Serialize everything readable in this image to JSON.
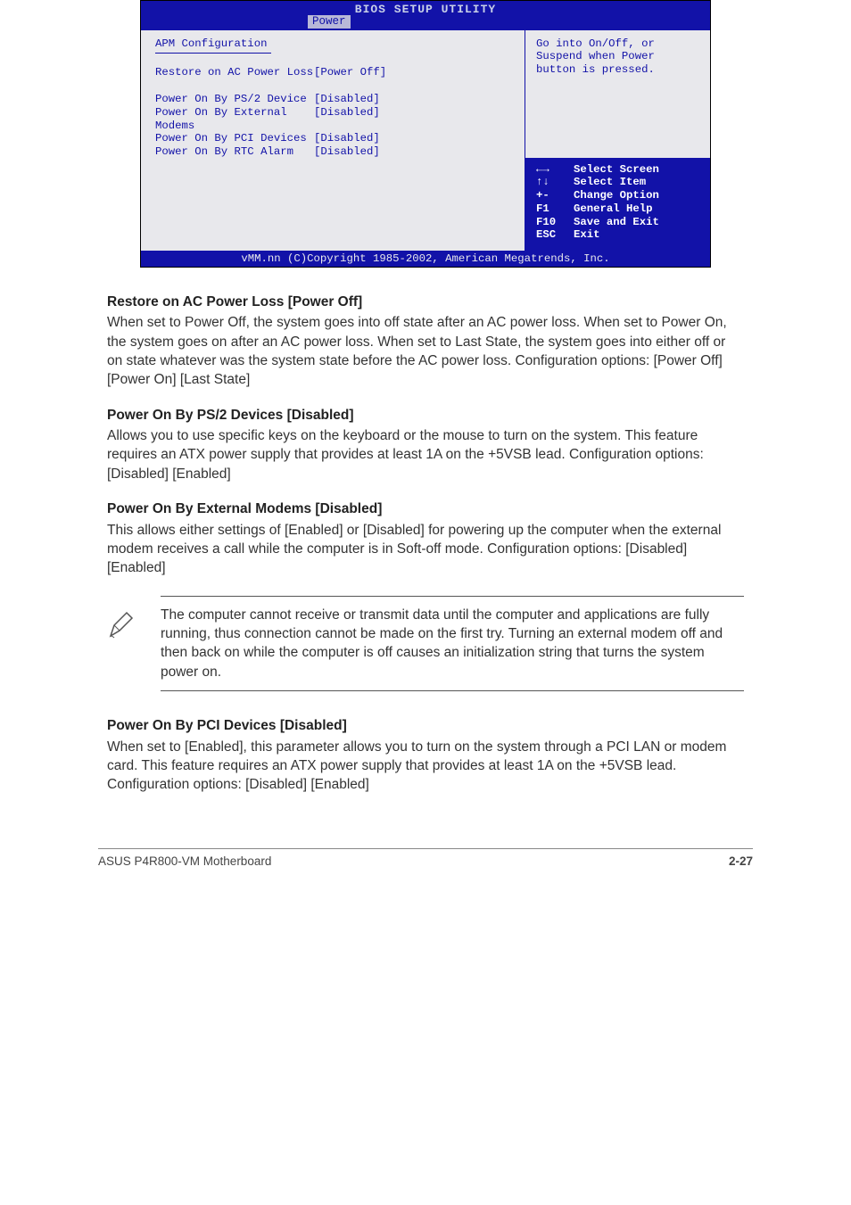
{
  "bios": {
    "title": "BIOS SETUP UTILITY",
    "active_tab": "Power",
    "left": {
      "section_heading": "APM Configuration",
      "settings": [
        {
          "label": "Restore on AC Power Loss",
          "value": "[Power Off]"
        }
      ],
      "settings2": [
        {
          "label": "Power On By PS/2 Device",
          "value": "[Disabled]"
        },
        {
          "label": "Power On By External Modems",
          "value": "[Disabled]"
        },
        {
          "label": "Power On By PCI Devices",
          "value": "[Disabled]"
        },
        {
          "label": "Power On By RTC Alarm",
          "value": "[Disabled]"
        }
      ]
    },
    "right": {
      "help": "Go into On/Off, or Suspend when Power button is pressed.",
      "nav": [
        {
          "key": "←→",
          "action": "Select Screen"
        },
        {
          "key": "↑↓",
          "action": "Select Item"
        },
        {
          "key": "+-",
          "action": "Change Option"
        },
        {
          "key": "F1",
          "action": "General Help"
        },
        {
          "key": "F10",
          "action": "Save and Exit"
        },
        {
          "key": "ESC",
          "action": "Exit"
        }
      ]
    },
    "footer": "vMM.nn (C)Copyright 1985-2002, American Megatrends, Inc."
  },
  "doc": {
    "h1": {
      "title": "Restore on AC Power Loss [Power Off]",
      "body": "When set to Power Off, the system goes into off state after an AC power loss. When set to Power On, the system goes on after an AC power loss. When set to Last State, the system goes into either off or on state whatever was the system state before the AC power loss. Configuration options: [Power Off] [Power On] [Last State]"
    },
    "h2": {
      "title": "Power On By PS/2 Devices [Disabled]",
      "body": "Allows you to use specific keys on the keyboard or the mouse to turn on the system. This feature requires an ATX power supply that provides at least 1A on the +5VSB lead. Configuration options: [Disabled] [Enabled]"
    },
    "h3": {
      "title": "Power On By External Modems [Disabled]",
      "body": "This allows either settings of [Enabled] or [Disabled] for powering up the computer when the external modem receives a call while the computer is in Soft-off mode. Configuration options: [Disabled] [Enabled]"
    },
    "note": "The computer cannot receive or transmit data until the computer and applications are fully running, thus connection cannot be made on the first try. Turning an external modem off and then back on while the computer is off causes an initialization string that turns the system power on.",
    "h4": {
      "title": "Power On By PCI Devices [Disabled]",
      "body": "When set to [Enabled], this parameter allows you to turn on the system through a PCI LAN or modem card. This feature requires an ATX power supply that provides at least 1A on the +5VSB lead. Configuration options: [Disabled] [Enabled]"
    },
    "footer_left": "ASUS P4R800-VM Motherboard",
    "footer_right": "2-27"
  }
}
